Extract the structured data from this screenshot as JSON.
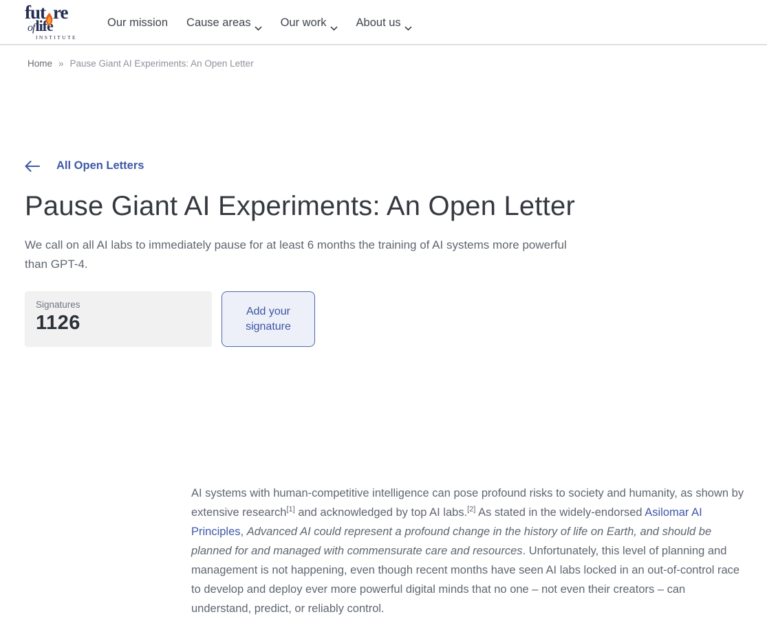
{
  "header": {
    "logo": {
      "word1_pre": "fut",
      "word1_post": "re",
      "word2_of": "of",
      "word2_rest": "life",
      "word3": "INSTITUTE"
    },
    "nav": [
      {
        "label": "Our mission",
        "dropdown": false
      },
      {
        "label": "Cause areas",
        "dropdown": true
      },
      {
        "label": "Our work",
        "dropdown": true
      },
      {
        "label": "About us",
        "dropdown": true
      }
    ]
  },
  "breadcrumb": {
    "home": "Home",
    "separator": "»",
    "current": "Pause Giant AI Experiments: An Open Letter"
  },
  "page": {
    "back_link": "All Open Letters",
    "title": "Pause Giant AI Experiments: An Open Letter",
    "subtitle": "We call on all AI labs to immediately pause for at least 6 months the training of AI systems more powerful than GPT-4.",
    "signatures": {
      "label": "Signatures",
      "count": "1126"
    },
    "add_signature_button": "Add your signature"
  },
  "article": {
    "paragraph_runs": [
      {
        "type": "text",
        "text": "AI systems with human-competitive intelligence can pose profound risks to society and humanity, as shown by extensive research"
      },
      {
        "type": "sup",
        "text": "[1]"
      },
      {
        "type": "text",
        "text": " and acknowledged by top AI labs."
      },
      {
        "type": "sup",
        "text": "[2]"
      },
      {
        "type": "text",
        "text": " As stated in the widely-endorsed "
      },
      {
        "type": "link",
        "text": "Asilomar AI Principles"
      },
      {
        "type": "text",
        "text": ", "
      },
      {
        "type": "italic",
        "text": "Advanced AI could represent a profound change in the history of life on Earth, and should be planned for and managed with commensurate care and resources"
      },
      {
        "type": "text",
        "text": ". Unfortunately, this level of planning and management is not happening, even though recent months have seen AI labs locked in an out-of-control race to develop and deploy ever more powerful digital minds that no one – not even their creators – can understand, predict, or reliably control."
      }
    ]
  },
  "colors": {
    "accent_blue": "#3e58a8",
    "logo_navy": "#232d4f",
    "flame_orange": "#e8611f",
    "flame_yellow": "#f6a02c",
    "card_bg": "#f1f1f2",
    "button_bg": "#edf0f9",
    "button_border": "#5066ae",
    "title_text": "#35393f",
    "body_text": "#5f6670"
  }
}
